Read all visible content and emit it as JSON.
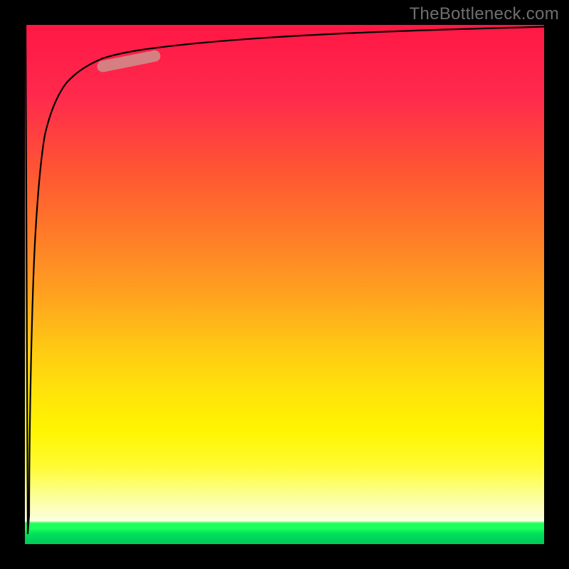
{
  "watermark": "TheBottleneck.com",
  "colors": {
    "frame": "#000000",
    "gradient_top": "#ff1744",
    "gradient_mid_top": "#ff7a29",
    "gradient_mid": "#ffe40a",
    "gradient_mid_bottom": "#fcff8a",
    "gradient_bottom": "#00c85a",
    "curve": "#000000",
    "highlight": "#d08a88"
  },
  "chart_data": {
    "type": "line",
    "title": "",
    "xlabel": "",
    "ylabel": "",
    "xlim": [
      0,
      100
    ],
    "ylim": [
      0,
      100
    ],
    "x": [
      0,
      0.2,
      0.5,
      1,
      1.5,
      2,
      3,
      4,
      5,
      7,
      10,
      15,
      20,
      25,
      30,
      40,
      50,
      60,
      70,
      80,
      90,
      100
    ],
    "values": [
      100,
      0,
      30,
      55,
      66,
      72,
      79,
      83,
      85.5,
      88,
      90,
      92,
      93.2,
      94,
      94.6,
      95.5,
      96.2,
      96.8,
      97.3,
      97.7,
      98,
      98.3
    ],
    "series": [
      {
        "name": "curve",
        "color": "#000000"
      }
    ],
    "highlight_segment": {
      "x_start": 15,
      "x_end": 25,
      "stroke": "#d08a88",
      "width": 16
    }
  }
}
